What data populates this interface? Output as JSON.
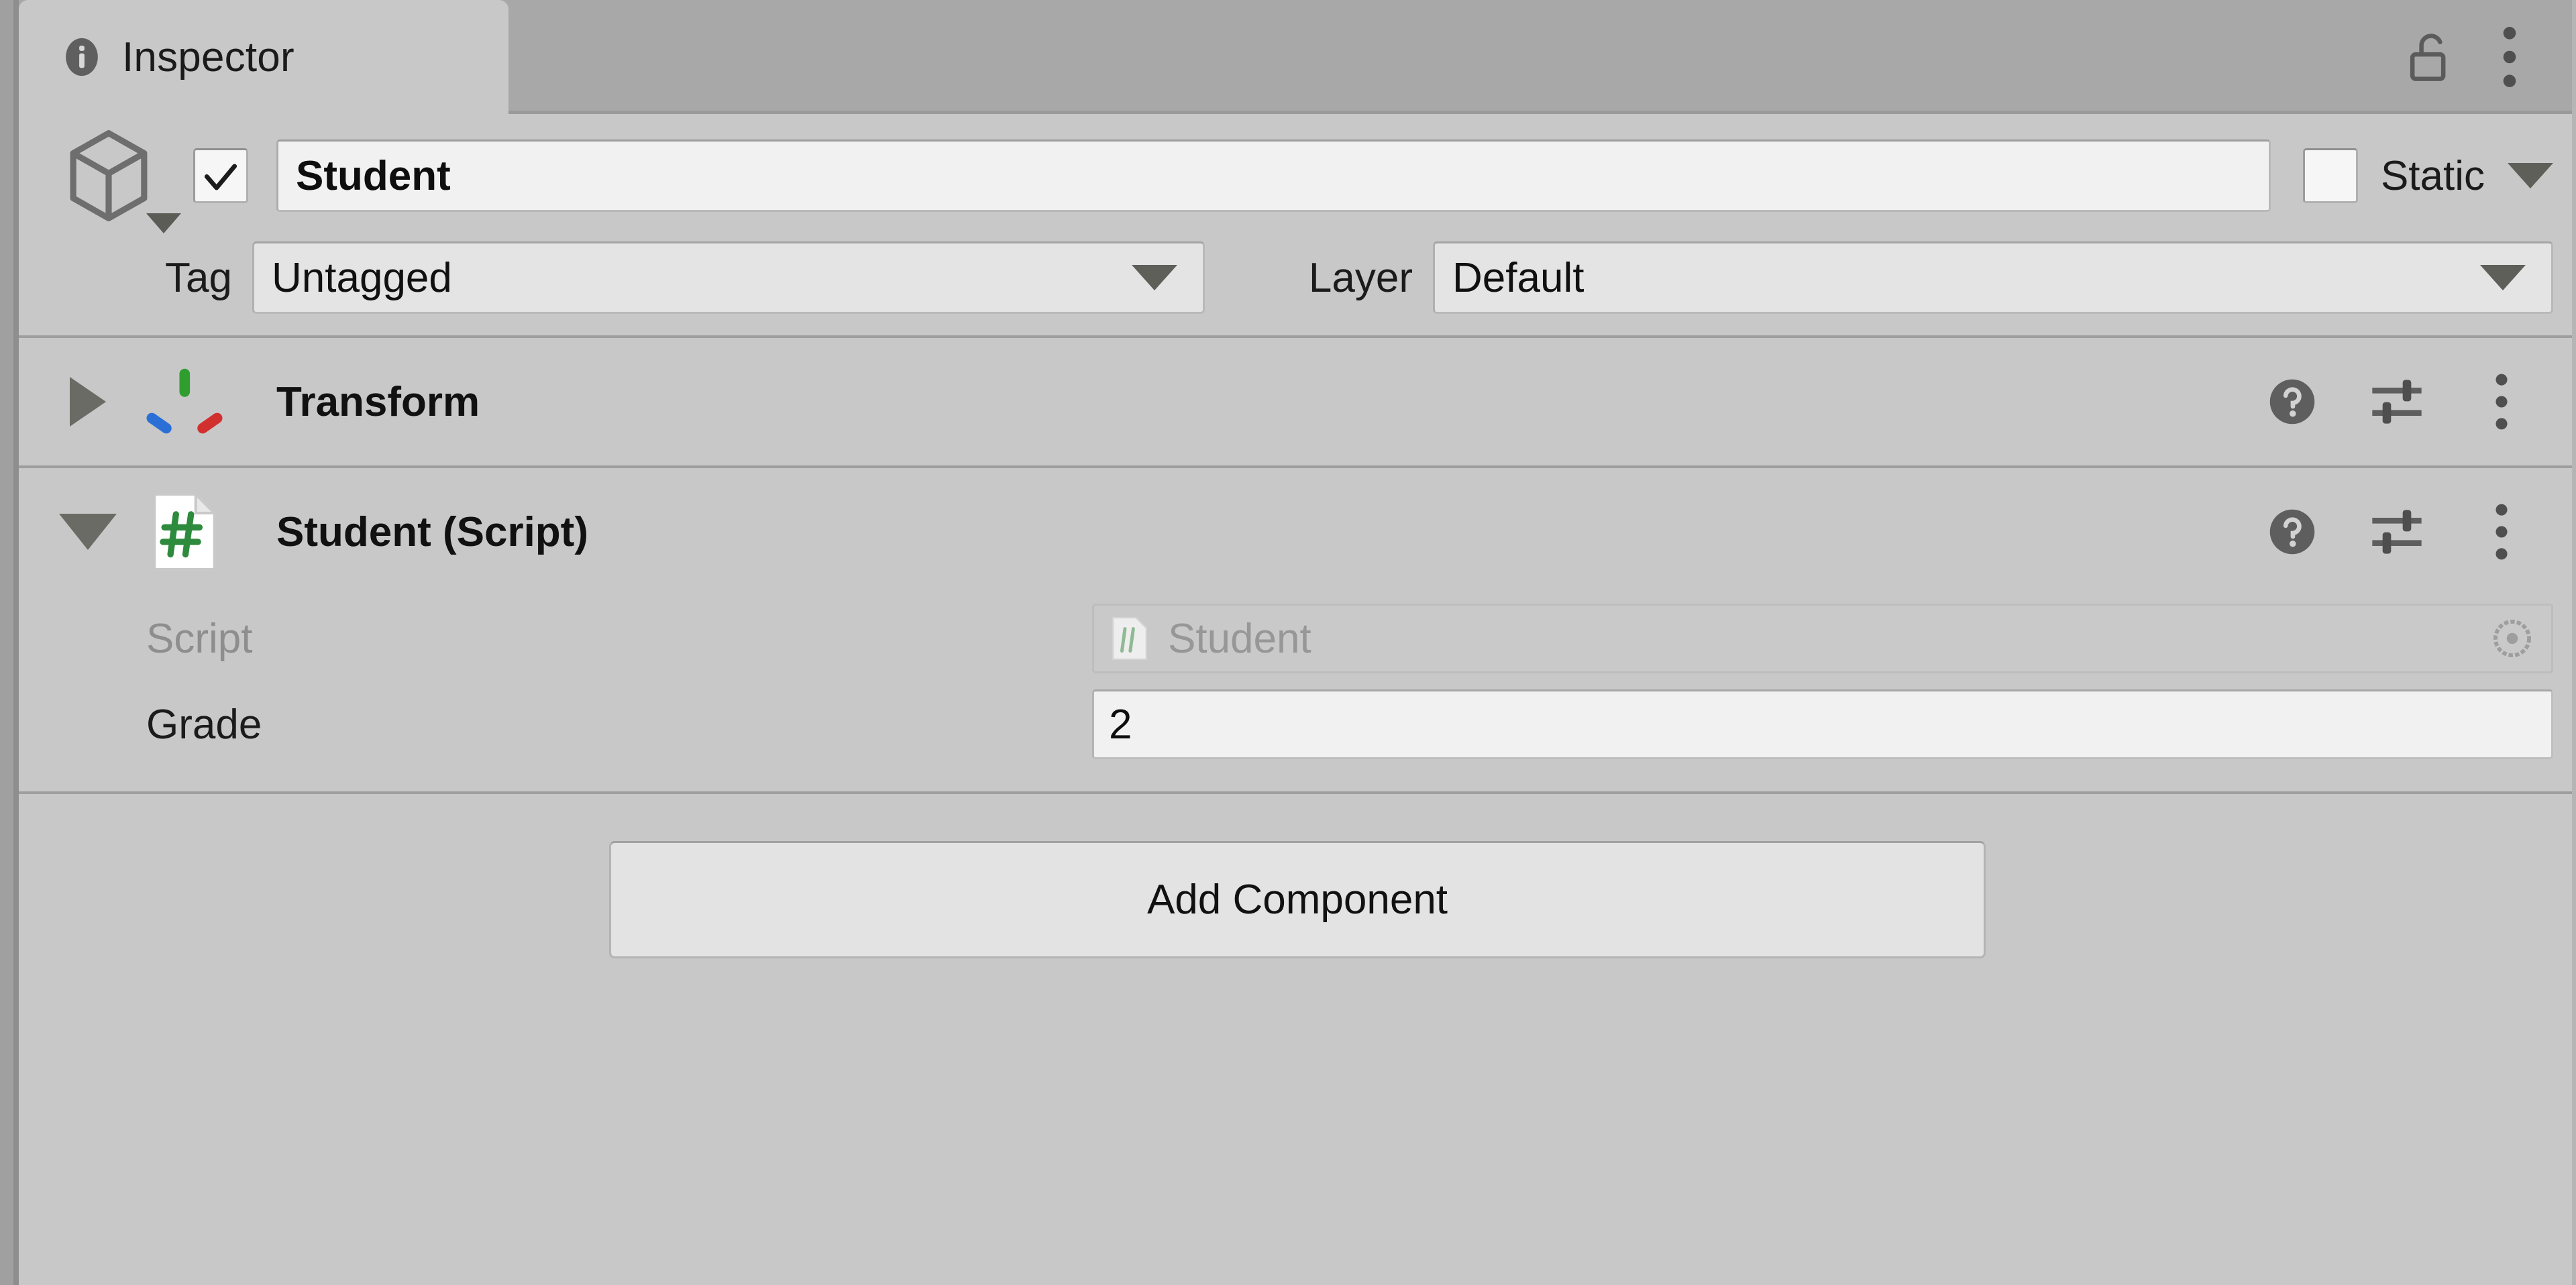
{
  "window": {
    "tab": {
      "label": "Inspector",
      "icon": "info-icon"
    },
    "actions": [
      {
        "name": "lock-toggle",
        "icon": "padlock-open-icon"
      },
      {
        "name": "tab-menu",
        "icon": "kebab-menu-icon"
      }
    ]
  },
  "gameobject": {
    "icon": "cube-icon",
    "enabled_checkbox": {
      "checked": true,
      "icon": "checkmark-icon"
    },
    "name": "Student",
    "static": {
      "label": "Static",
      "checked": false,
      "dropdown_icon": "chevron-down-icon"
    },
    "tag": {
      "label": "Tag",
      "value": "Untagged",
      "dropdown_icon": "chevron-down-icon"
    },
    "layer": {
      "label": "Layer",
      "value": "Default",
      "dropdown_icon": "chevron-down-icon"
    }
  },
  "components": [
    {
      "title": "Transform",
      "icon": "transform-gizmo-icon",
      "expanded": false,
      "foldout_icon": "triangle-right-icon",
      "actions": [
        {
          "name": "help-button",
          "icon": "help-circle-icon"
        },
        {
          "name": "preset-button",
          "icon": "settings-sliders-icon"
        },
        {
          "name": "component-menu-button",
          "icon": "kebab-menu-icon"
        }
      ]
    },
    {
      "title": "Student (Script)",
      "icon": "csharp-script-icon",
      "expanded": true,
      "foldout_icon": "triangle-down-icon",
      "actions": [
        {
          "name": "help-button",
          "icon": "help-circle-icon"
        },
        {
          "name": "preset-button",
          "icon": "settings-sliders-icon"
        },
        {
          "name": "component-menu-button",
          "icon": "kebab-menu-icon"
        }
      ],
      "properties": [
        {
          "label": "Script",
          "value": "Student",
          "type": "object-reference",
          "disabled": true,
          "value_icon": "csharp-script-icon",
          "picker_icon": "object-picker-icon"
        },
        {
          "label": "Grade",
          "value": "2",
          "type": "number",
          "disabled": false
        }
      ]
    }
  ],
  "footer": {
    "add_component_label": "Add Component"
  },
  "colors": {
    "panel_background": "#c8c8c8",
    "tabbar_background": "#a8a8a8",
    "field_background": "#f1f1f1",
    "dropdown_background": "#e4e4e4",
    "text_primary": "#1b1b1b",
    "text_disabled": "#8e8e8e",
    "axis_x_red": "#d22f2f",
    "axis_y_green": "#2f9e2f",
    "axis_z_blue": "#2a6fd6",
    "csharp_green": "#2e8b3d"
  }
}
